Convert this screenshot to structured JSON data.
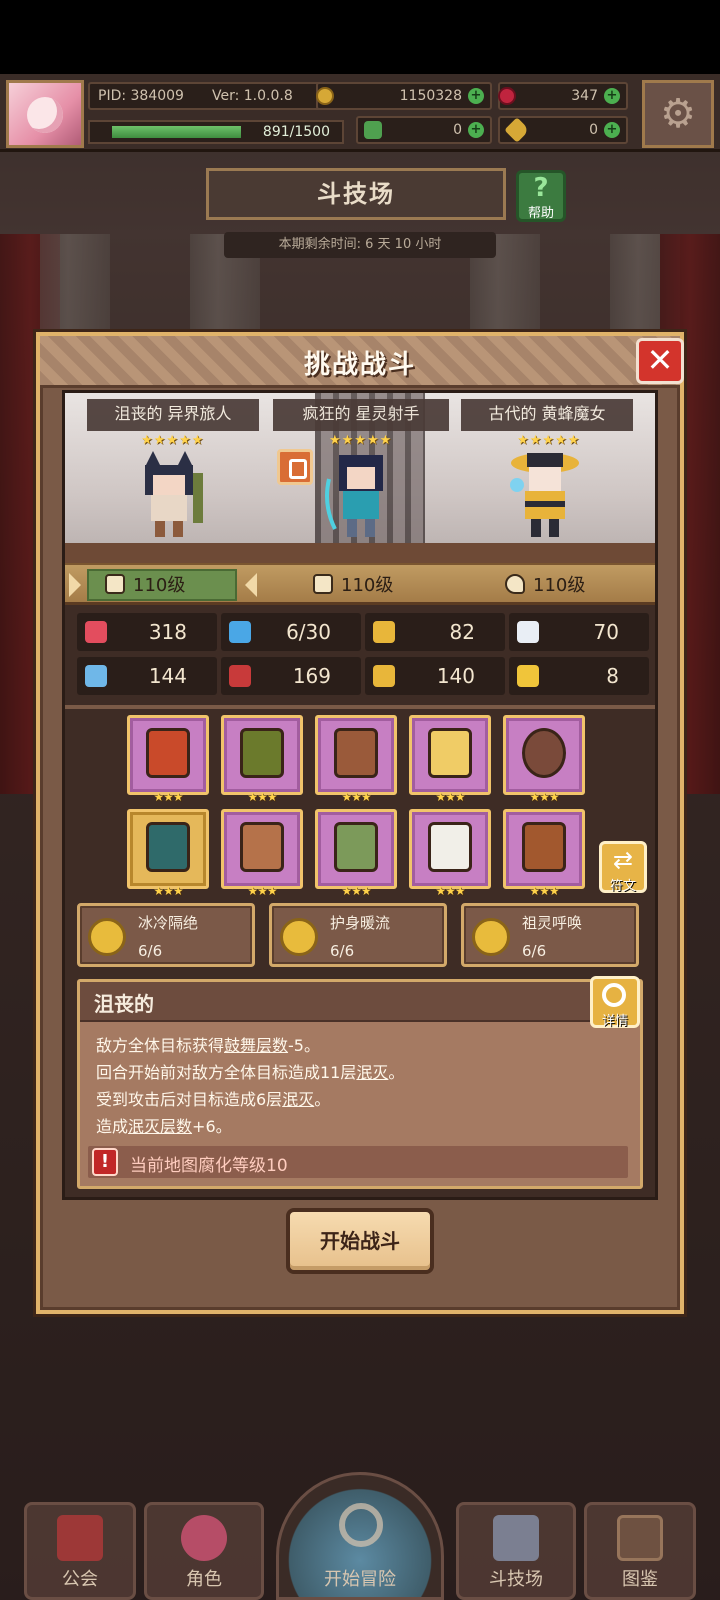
{
  "topbar": {
    "pid": "PID: 384009",
    "version": "Ver: 1.0.0.8",
    "gold": "1150328",
    "gems": "347",
    "xp": "891/1500",
    "xp_fraction": 0.594,
    "clover_count": "0",
    "key_count": "0"
  },
  "arena": {
    "title": "斗技场",
    "help_label": "帮助",
    "time_left": "本期剩余时间: 6 天 10 小时"
  },
  "modal": {
    "title": "挑战战斗",
    "close_icon": "close-icon",
    "heroes": [
      {
        "name": "沮丧的 异界旅人",
        "stars": "★★★★★",
        "level": "110级"
      },
      {
        "name": "疯狂的 星灵射手",
        "stars": "★★★★★",
        "level": "110级"
      },
      {
        "name": "古代的 黄蜂魔女",
        "stars": "★★★★★",
        "level": "110级"
      }
    ],
    "stats": [
      {
        "icon": "heart-icon",
        "value": "318",
        "color": "#e34d5e"
      },
      {
        "icon": "drop-icon",
        "value": "6/30",
        "color": "#4aa7e6"
      },
      {
        "icon": "shield-icon",
        "value": "82",
        "color": "#e8b63a"
      },
      {
        "icon": "wing-icon",
        "value": "70",
        "color": "#e9eef5"
      },
      {
        "icon": "fist-icon",
        "value": "144",
        "color": "#6fb7e8"
      },
      {
        "icon": "book-icon",
        "value": "169",
        "color": "#c83a3a"
      },
      {
        "icon": "boot-icon",
        "value": "140",
        "color": "#e8b63a"
      },
      {
        "icon": "horseshoe-icon",
        "value": "8",
        "color": "#f0c53a"
      }
    ],
    "equipment": [
      {
        "icon": "staff-icon",
        "stars": "★★★"
      },
      {
        "icon": "armor-icon",
        "stars": "★★★"
      },
      {
        "icon": "amulet-icon",
        "stars": "★★★"
      },
      {
        "icon": "gem-icon",
        "stars": "★★★"
      },
      {
        "icon": "ring-icon",
        "stars": "★★★"
      },
      {
        "icon": "helmet-icon",
        "stars": "★★★"
      },
      {
        "icon": "chest-icon",
        "stars": "★★★"
      },
      {
        "icon": "glove-icon",
        "stars": "★★★"
      },
      {
        "icon": "belt-icon",
        "stars": "★★★"
      },
      {
        "icon": "boots-icon",
        "stars": "★★★"
      }
    ],
    "rune_label": "符文",
    "sets": [
      {
        "name": "冰冷隔绝",
        "count": "6/6"
      },
      {
        "name": "护身暖流",
        "count": "6/6"
      },
      {
        "name": "祖灵呼唤",
        "count": "6/6"
      }
    ],
    "trait": {
      "title": "沮丧的",
      "detail_label": "详情",
      "line1_a": "敌方全体目标获得",
      "line1_u": "鼓舞层数",
      "line1_b": "-5。",
      "line2_a": "回合开始前对敌方全体目标造成11层",
      "line2_u": "泯灭",
      "line2_b": "。",
      "line3_a": "受到攻击后对目标造成6层",
      "line3_u": "泯灭",
      "line3_b": "。",
      "line4_a": "造成",
      "line4_u": "泯灭层数",
      "line4_b": "+6。",
      "warning": "当前地图腐化等级10"
    },
    "start_button": "开始战斗"
  },
  "nav": {
    "guild": "公会",
    "character": "角色",
    "adventure": "开始冒险",
    "arena": "斗技场",
    "codex": "图鉴"
  }
}
